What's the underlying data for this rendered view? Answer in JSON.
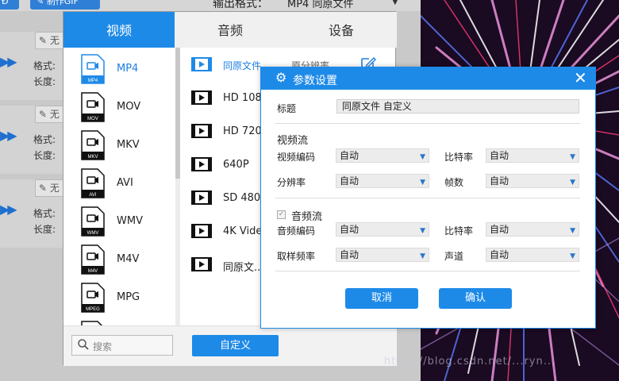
{
  "toolbar": {
    "btn_a": "Ð",
    "btn_b": "✎ 制作GIF",
    "output_label": "输出格式：",
    "output_value": "MP4 同原文件"
  },
  "queue_rows": [
    {
      "name": "✎ 无",
      "format_label": "格式:",
      "length_label": "长度:"
    },
    {
      "name": "✎ 无",
      "format_label": "格式:",
      "length_label": "长度:"
    },
    {
      "name": "✎ 无",
      "format_label": "格式:",
      "length_label": "长度:"
    }
  ],
  "tabs": [
    "视频",
    "音频",
    "设备"
  ],
  "formats": [
    "MP4",
    "MOV",
    "MKV",
    "AVI",
    "WMV",
    "M4V",
    "MPG"
  ],
  "format_badges": [
    "MP4",
    "MOV",
    "MKV",
    "AVI",
    "WMV",
    "M4V",
    "MPEG"
  ],
  "resolutions": [
    {
      "name": "同原文件",
      "size": "原分辨率"
    },
    {
      "name": "HD 1080",
      "size": ""
    },
    {
      "name": "HD 720P",
      "size": ""
    },
    {
      "name": "640P",
      "size": ""
    },
    {
      "name": "SD 480P",
      "size": ""
    },
    {
      "name": "4K Vide",
      "size": ""
    },
    {
      "name": "同原文...",
      "size": ""
    }
  ],
  "search": {
    "placeholder": "搜索"
  },
  "custom_button": "自定义",
  "dialog": {
    "title": "参数设置",
    "title_label": "标题",
    "title_value": "同原文件 自定义",
    "video_section": "视频流",
    "video_codec_label": "视频编码",
    "video_codec_value": "自动",
    "video_bitrate_label": "比特率",
    "video_bitrate_value": "自动",
    "resolution_label": "分辨率",
    "resolution_value": "自动",
    "framerate_label": "帧数",
    "framerate_value": "自动",
    "audio_section": "音频流",
    "audio_codec_label": "音频编码",
    "audio_codec_value": "自动",
    "audio_bitrate_label": "比特率",
    "audio_bitrate_value": "自动",
    "samplerate_label": "取样频率",
    "samplerate_value": "自动",
    "channel_label": "声道",
    "channel_value": "自动",
    "cancel": "取消",
    "confirm": "确认"
  },
  "watermark": "https://blog.csdn.net/...ryn...",
  "colors": {
    "accent": "#1e8ae8"
  }
}
